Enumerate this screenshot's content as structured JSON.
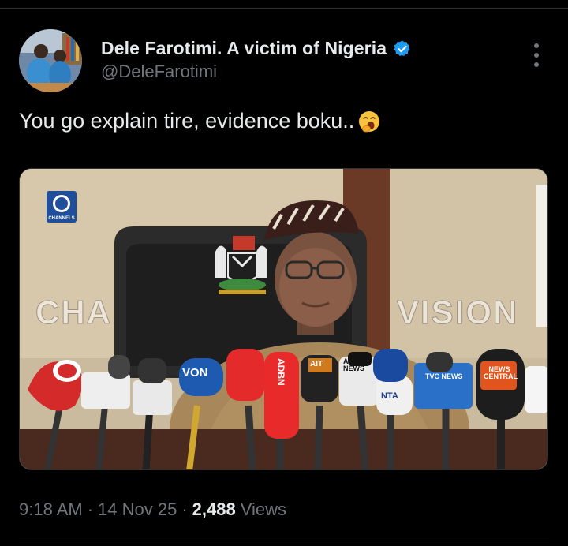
{
  "author": {
    "display_name": "Dele Farotimi. A victim of Nigeria",
    "handle": "@DeleFarotimi",
    "verified": true,
    "verified_color": "#1d9bf0"
  },
  "tweet": {
    "text": "You go explain tire, evidence boku..",
    "emoji": "yawning-face-icon"
  },
  "media": {
    "channel_logo_label": "CHANNELS",
    "watermark_left": "CHA",
    "watermark_right": "VISION",
    "mic_labels": {
      "von": "VON",
      "aitv": "AIT",
      "arise": "ARISE NEWS",
      "nta": "NTA",
      "tvc": "TVC NEWS",
      "news_central": "NEWS CENTRAL",
      "adbn": "ADBN"
    }
  },
  "meta": {
    "time": "9:18 AM",
    "date": "14 Nov 25",
    "views_count": "2,488",
    "views_label": "Views"
  },
  "icons": {
    "more": "more-options-icon",
    "verified": "verified-badge-icon"
  }
}
